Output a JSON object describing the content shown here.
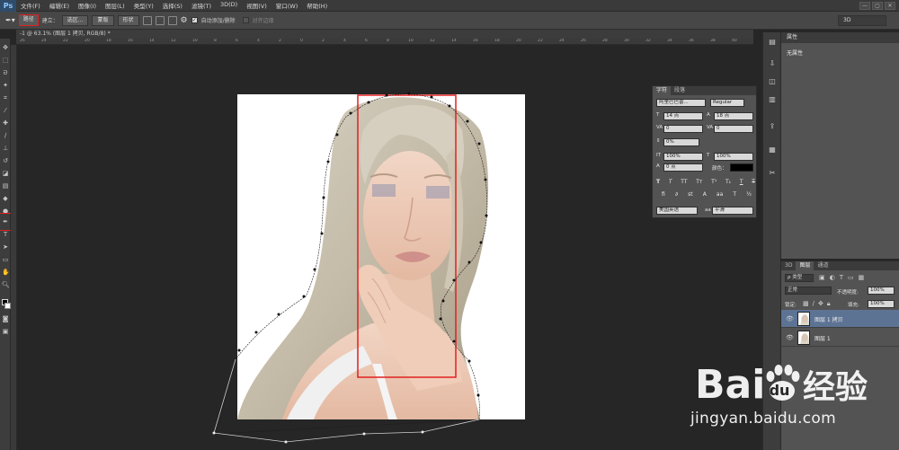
{
  "app": {
    "logo": "Ps"
  },
  "menu": [
    "文件(F)",
    "编辑(E)",
    "图像(I)",
    "图层(L)",
    "类型(Y)",
    "选择(S)",
    "滤镜(T)",
    "3D(D)",
    "视图(V)",
    "窗口(W)",
    "帮助(H)"
  ],
  "window_controls": [
    "—",
    "▢",
    "✕"
  ],
  "options_bar": {
    "mode": "路径",
    "make_label": "建立：",
    "selection_btn": "选区...",
    "mask_btn": "蒙版",
    "shape_btn": "形状",
    "auto_add_delete": "自动添加/删除",
    "align_edges": "对齐边缘",
    "workspace": "3D"
  },
  "document": {
    "tab_title": "-1 @ 63.1% (图层 1 拷贝, RGB/8) *",
    "ruler_labels": [
      "26",
      "24",
      "22",
      "20",
      "18",
      "16",
      "14",
      "12",
      "10",
      "8",
      "6",
      "4",
      "2",
      "0",
      "2",
      "4",
      "6",
      "8",
      "10",
      "12",
      "14",
      "16",
      "18",
      "20",
      "22",
      "24",
      "26",
      "28",
      "30",
      "32",
      "34",
      "36",
      "38",
      "40"
    ]
  },
  "character_panel": {
    "tabs": [
      "字符",
      "段落"
    ],
    "font_family": "阿里巴巴普...",
    "font_style": "Regular",
    "size": "14 点",
    "leading": "18 点",
    "tracking_va": "0",
    "kerning": "0",
    "scale_pct": "0%",
    "vertical_scale": "100%",
    "horizontal_scale": "100%",
    "baseline": "0 点",
    "color_label": "颜色：",
    "language": "美国英语",
    "antialias": "平滑",
    "aa_label": "aa"
  },
  "properties_panel": {
    "title": "属性",
    "empty_text": "无属性"
  },
  "layers_panel": {
    "tabs": [
      "3D",
      "图层",
      "通道"
    ],
    "filter": "ρ 类型",
    "blend_mode": "正常",
    "opacity_label": "不透明度:",
    "opacity": "100%",
    "lock_label": "锁定:",
    "fill_label": "填充:",
    "fill": "100%",
    "layers": [
      {
        "name": "图层 1 拷贝",
        "selected": true
      },
      {
        "name": "图层 1",
        "selected": false
      }
    ]
  },
  "watermark": {
    "brand": "Bai",
    "brand_cn": "经验",
    "url": "jingyan.baidu.com"
  },
  "colors": {
    "highlight": "#e02020",
    "panel": "#535353",
    "selected_layer": "#5d7394"
  }
}
